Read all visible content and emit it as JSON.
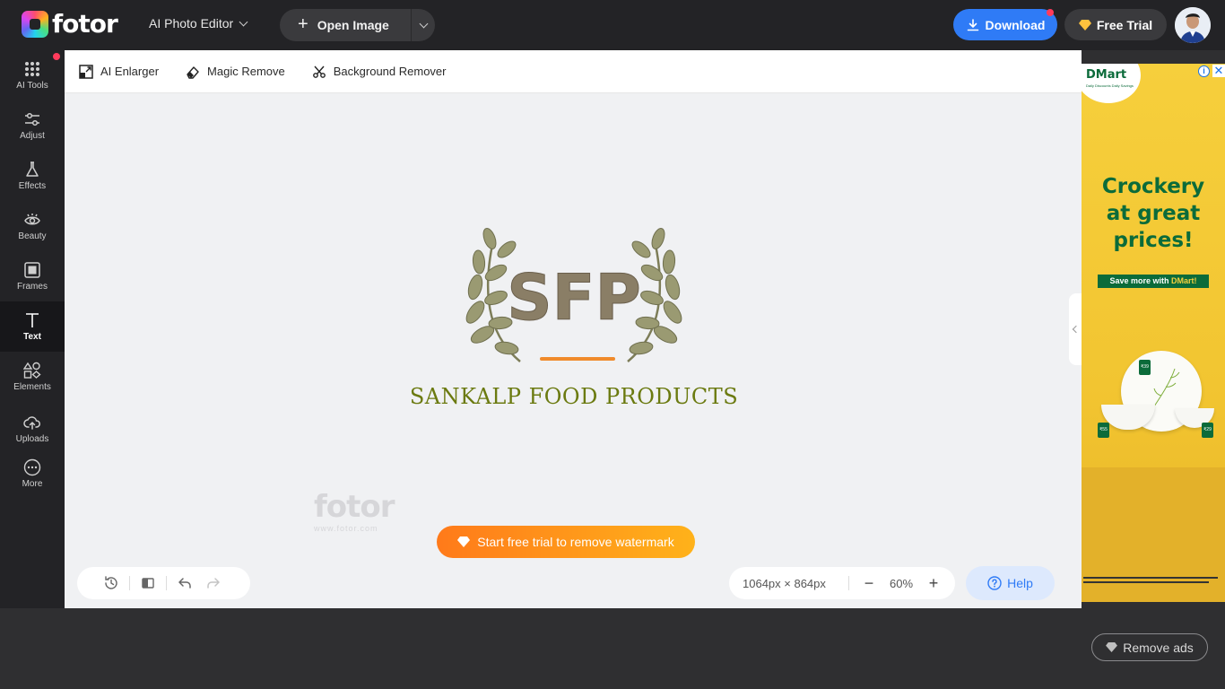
{
  "header": {
    "logo_text": "fotor",
    "editor_mode": "AI Photo Editor",
    "open_image": "Open Image",
    "download": "Download",
    "free_trial": "Free Trial"
  },
  "sidebar": {
    "items": [
      {
        "label": "AI Tools",
        "icon": "grid-dots-icon"
      },
      {
        "label": "Adjust",
        "icon": "sliders-icon"
      },
      {
        "label": "Effects",
        "icon": "flask-icon"
      },
      {
        "label": "Beauty",
        "icon": "eye-icon"
      },
      {
        "label": "Frames",
        "icon": "frame-icon"
      },
      {
        "label": "Text",
        "icon": "text-icon"
      },
      {
        "label": "Elements",
        "icon": "shapes-icon"
      },
      {
        "label": "Uploads",
        "icon": "cloud-upload-icon"
      },
      {
        "label": "More",
        "icon": "more-dots-icon"
      }
    ],
    "active": "Text"
  },
  "subtoolbar": {
    "ai_enlarger": "AI Enlarger",
    "magic_remove": "Magic Remove",
    "background_remover": "Background Remover"
  },
  "canvas": {
    "logo_letters": "SFP",
    "brand_title": "SANKALP FOOD PRODUCTS",
    "watermark_main": "fotor",
    "watermark_sub": "www.fotor.com",
    "watermark_cta": "Start free trial to remove watermark"
  },
  "bottom": {
    "image_size": "1064px × 864px",
    "zoom": "60%",
    "help": "Help"
  },
  "ad": {
    "brand": "DMart",
    "brand_sub": "Daily Discounts Daily Savings",
    "headline_1": "Crockery",
    "headline_2": "at great",
    "headline_3": "prices!",
    "tag_prefix": "Save more with ",
    "tag_brand": "DMart!",
    "price_1": "₹39",
    "price_2": "₹55",
    "price_3": "₹29"
  },
  "remove_ads": "Remove ads",
  "colors": {
    "accent_blue": "#2f7bf6",
    "brand_green": "#6b7a10",
    "cta_orange": "#ff7a1a"
  }
}
